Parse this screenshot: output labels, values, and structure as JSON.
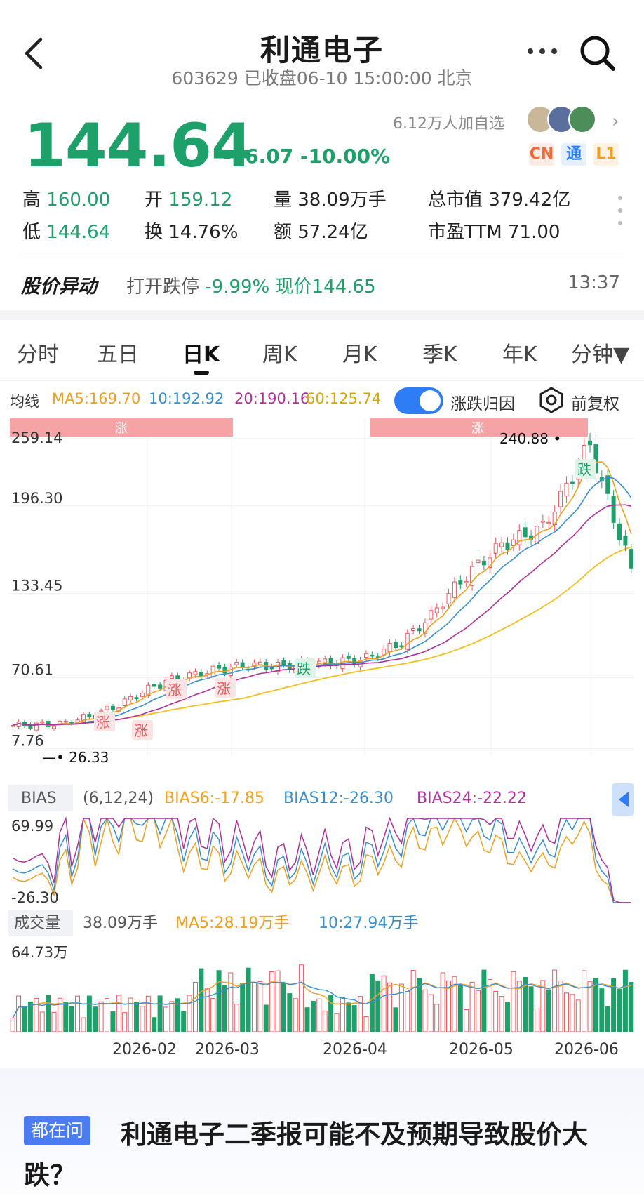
{
  "header": {
    "title": "利通电子",
    "subtitle": "603629 已收盘06-10 15:00:00 北京"
  },
  "quote": {
    "price": "144.64",
    "change": "-16.07 -10.00%",
    "watchers": "6.12万人加自选",
    "badges": [
      "CN",
      "通",
      "L1"
    ],
    "stats": {
      "high_label": "高",
      "high": "160.00",
      "open_label": "开",
      "open": "159.12",
      "volume": "量 38.09万手",
      "mktcap": "总市值 379.42亿",
      "low_label": "低",
      "low": "144.64",
      "turnover": "换 14.76%",
      "amount": "额 57.24亿",
      "pe": "市盈TTM 71.00"
    }
  },
  "alert": {
    "title": "股价异动",
    "prefix": "打开跌停",
    "pct": "-9.99%",
    "price": "现价144.65",
    "time": "13:37"
  },
  "tabs": [
    "分时",
    "五日",
    "日K",
    "周K",
    "月K",
    "季K",
    "年K",
    "分钟▼"
  ],
  "active_tab": "日K",
  "ma": {
    "label": "均线",
    "ma5": "MA5:169.70",
    "ma10": "10:192.92",
    "ma20": "20:190.16",
    "ma60": "60:125.74",
    "toggle_label": "涨跌归因",
    "fq_label": "前复权"
  },
  "colors": {
    "up": "#f0565c",
    "down": "#1ea06a",
    "ma5": "#f0a020",
    "ma10": "#3a8fd0",
    "ma20": "#b0309a",
    "ma60": "#f0c020",
    "accent": "#2e7cf6"
  },
  "chart_data": {
    "type": "candlestick",
    "price_axis": [
      "259.14",
      "196.30",
      "133.45",
      "70.61",
      "7.76"
    ],
    "annotations": {
      "high": "240.88",
      "low": "26.33",
      "rise_tag": "涨",
      "fall_tag": "跌"
    },
    "ylim": [
      7.76,
      259.14
    ],
    "x_labels": [
      "2026-02",
      "2026-03",
      "2026-04",
      "2026-05",
      "2026-06"
    ],
    "close_points": [
      [
        0,
        30
      ],
      [
        8,
        31
      ],
      [
        14,
        38
      ],
      [
        18,
        45
      ],
      [
        22,
        55
      ],
      [
        26,
        63
      ],
      [
        30,
        67
      ],
      [
        35,
        72
      ],
      [
        40,
        75
      ],
      [
        45,
        74
      ],
      [
        50,
        76
      ],
      [
        55,
        77
      ],
      [
        60,
        80
      ],
      [
        66,
        92
      ],
      [
        71,
        112
      ],
      [
        75,
        133
      ],
      [
        79,
        150
      ],
      [
        83,
        165
      ],
      [
        87,
        172
      ],
      [
        90,
        178
      ],
      [
        93,
        200
      ],
      [
        96,
        225
      ],
      [
        98,
        240
      ],
      [
        100,
        210
      ],
      [
        102,
        185
      ],
      [
        104,
        160
      ],
      [
        105,
        144.64
      ]
    ],
    "bias": {
      "label": "BIAS",
      "params": "(6,12,24)",
      "bias6": "BIAS6:-17.85",
      "bias12": "BIAS12:-26.30",
      "bias24": "BIAS24:-22.22",
      "axis_top": "69.99",
      "axis_bottom": "-26.30"
    },
    "volume": {
      "label": "成交量",
      "value": "38.09万手",
      "ma5": "MA5:28.19万手",
      "ma10": "10:27.94万手",
      "axis_top": "64.73万"
    }
  },
  "question": {
    "badge": "都在问",
    "text": "利通电子二季报可能不及预期导致股价大跌？"
  }
}
